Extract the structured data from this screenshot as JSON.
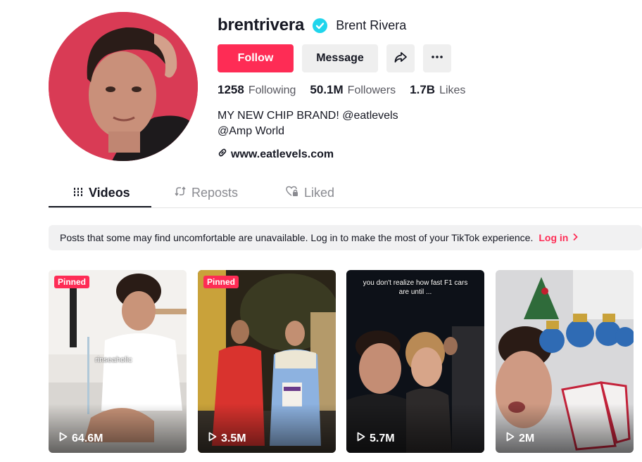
{
  "profile": {
    "username": "brentrivera",
    "nickname": "Brent Rivera",
    "verified_icon": "verified-check-icon",
    "bio_line1": "MY NEW CHIP BRAND! @eatlevels",
    "bio_line2": "@Amp World",
    "link": "www.eatlevels.com",
    "avatar_bg": "#d93b55"
  },
  "actions": {
    "follow_label": "Follow",
    "message_label": "Message",
    "share_icon": "share-icon",
    "more_icon": "more-icon"
  },
  "stats": {
    "following_count": "1258",
    "following_label": "Following",
    "followers_count": "50.1M",
    "followers_label": "Followers",
    "likes_count": "1.7B",
    "likes_label": "Likes"
  },
  "tabs": {
    "videos": "Videos",
    "reposts": "Reposts",
    "liked": "Liked"
  },
  "notice": {
    "text": "Posts that some may find uncomfortable are unavailable. Log in to make the most of your TikTok experience.",
    "login_label": "Log in"
  },
  "videos": [
    {
      "badge": "Pinned",
      "views": "64.6M",
      "caption": "rinseaholic"
    },
    {
      "badge": "Pinned",
      "views": "3.5M",
      "caption": ""
    },
    {
      "badge": "",
      "views": "5.7M",
      "caption": "you don't realize how fast F1 cars are until ..."
    },
    {
      "badge": "",
      "views": "2M",
      "caption": ""
    }
  ],
  "colors": {
    "accent": "#fe2c55",
    "verified": "#20d5ec",
    "text": "#161823",
    "muted": "#8a8b91"
  }
}
